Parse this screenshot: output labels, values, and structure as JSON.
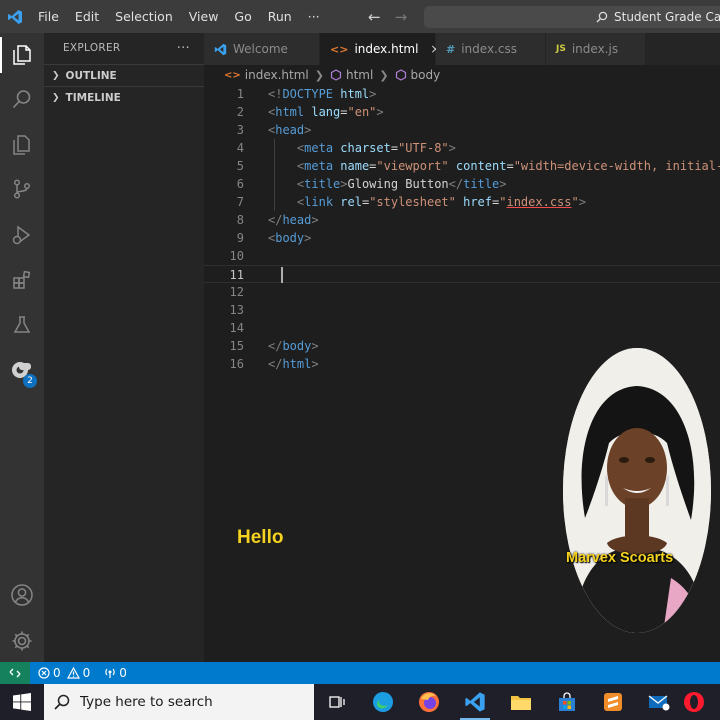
{
  "titlebar": {
    "menu": [
      "File",
      "Edit",
      "Selection",
      "View",
      "Go",
      "Run",
      "···"
    ],
    "command_center": "Student Grade Calculator"
  },
  "activitybar": {
    "items": [
      "explorer-icon",
      "search-icon",
      "source-control-icon",
      "run-debug-icon",
      "extensions-icon",
      "testing-icon",
      "remote-icon"
    ],
    "remote_badge": "2",
    "bottom": [
      "account-icon",
      "gear-icon"
    ]
  },
  "sidebar": {
    "title": "EXPLORER",
    "more": "···",
    "sections": [
      "OUTLINE",
      "TIMELINE"
    ]
  },
  "tabs": [
    {
      "label": "Welcome",
      "icon": "vscode-icon",
      "active": false
    },
    {
      "label": "index.html",
      "icon": "html-icon",
      "active": true
    },
    {
      "label": "index.css",
      "icon": "css-icon",
      "active": false
    },
    {
      "label": "index.js",
      "icon": "js-icon",
      "active": false
    }
  ],
  "tab_glyphs": {
    "html": "<>",
    "css": "#",
    "js": "JS",
    "close": "×"
  },
  "breadcrumb": [
    "index.html",
    "html",
    "body"
  ],
  "editor": {
    "current_line": 11,
    "lines": [
      {
        "n": "1",
        "tokens": [
          [
            "p",
            "<!"
          ],
          [
            "t",
            "DOCTYPE "
          ],
          [
            "a",
            "html"
          ],
          [
            "p",
            ">"
          ]
        ]
      },
      {
        "n": "2",
        "tokens": [
          [
            "p",
            "<"
          ],
          [
            "t",
            "html "
          ],
          [
            "a",
            "lang"
          ],
          [
            "w",
            "="
          ],
          [
            "s",
            "\"en\""
          ],
          [
            "p",
            ">"
          ]
        ]
      },
      {
        "n": "3",
        "tokens": [
          [
            "p",
            "<"
          ],
          [
            "t",
            "head"
          ],
          [
            "p",
            ">"
          ]
        ]
      },
      {
        "n": "4",
        "tokens": [
          [
            "w",
            "    "
          ],
          [
            "p",
            "<"
          ],
          [
            "t",
            "meta "
          ],
          [
            "a",
            "charset"
          ],
          [
            "w",
            "="
          ],
          [
            "s",
            "\"UTF-8\""
          ],
          [
            "p",
            ">"
          ]
        ]
      },
      {
        "n": "5",
        "tokens": [
          [
            "w",
            "    "
          ],
          [
            "p",
            "<"
          ],
          [
            "t",
            "meta "
          ],
          [
            "a",
            "name"
          ],
          [
            "w",
            "="
          ],
          [
            "s",
            "\"viewport\" "
          ],
          [
            "a",
            "content"
          ],
          [
            "w",
            "="
          ],
          [
            "s",
            "\"width=device-width, initial-"
          ]
        ]
      },
      {
        "n": "6",
        "tokens": [
          [
            "w",
            "    "
          ],
          [
            "p",
            "<"
          ],
          [
            "t",
            "title"
          ],
          [
            "p",
            ">"
          ],
          [
            "w",
            "Glowing Button"
          ],
          [
            "p",
            "</"
          ],
          [
            "t",
            "title"
          ],
          [
            "p",
            ">"
          ]
        ]
      },
      {
        "n": "7",
        "tokens": [
          [
            "w",
            "    "
          ],
          [
            "p",
            "<"
          ],
          [
            "t",
            "link "
          ],
          [
            "a",
            "rel"
          ],
          [
            "w",
            "="
          ],
          [
            "s",
            "\"stylesheet\" "
          ],
          [
            "a",
            "href"
          ],
          [
            "w",
            "="
          ],
          [
            "s",
            "\""
          ],
          [
            "su",
            "index.css"
          ],
          [
            "s",
            "\""
          ],
          [
            "p",
            ">"
          ]
        ]
      },
      {
        "n": "8",
        "tokens": [
          [
            "p",
            "</"
          ],
          [
            "t",
            "head"
          ],
          [
            "p",
            ">"
          ]
        ]
      },
      {
        "n": "9",
        "tokens": [
          [
            "p",
            "<"
          ],
          [
            "t",
            "body"
          ],
          [
            "p",
            ">"
          ]
        ]
      },
      {
        "n": "10",
        "tokens": []
      },
      {
        "n": "11",
        "tokens": []
      },
      {
        "n": "12",
        "tokens": []
      },
      {
        "n": "13",
        "tokens": []
      },
      {
        "n": "14",
        "tokens": []
      },
      {
        "n": "15",
        "tokens": [
          [
            "p",
            "</"
          ],
          [
            "t",
            "body"
          ],
          [
            "p",
            ">"
          ]
        ]
      },
      {
        "n": "16",
        "tokens": [
          [
            "p",
            "</"
          ],
          [
            "t",
            "html"
          ],
          [
            "p",
            ">"
          ]
        ]
      }
    ]
  },
  "statusbar": {
    "errors": "0",
    "warnings": "0",
    "ports": "0"
  },
  "taskbar": {
    "search_placeholder": "Type here to search"
  },
  "overlay": {
    "caption": "Hello",
    "presenter_name": "Marvex Scoarts"
  },
  "colors": {
    "caption": "#f4d21f",
    "statusbar": "#007acc",
    "remote": "#16825d"
  }
}
